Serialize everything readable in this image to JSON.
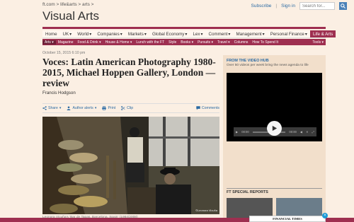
{
  "breadcrumb": {
    "text": "ft.com > life&arts > arts >"
  },
  "top": {
    "subscribe": "Subscribe",
    "separator": "|",
    "signin": "Sign in",
    "search_placeholder": "Search for..."
  },
  "section": {
    "title": "Visual Arts"
  },
  "nav": {
    "items": [
      "Home",
      "UK",
      "World",
      "Companies",
      "Markets",
      "Global Economy",
      "Lex",
      "Comment",
      "Management",
      "Personal Finance",
      "Life & Arts"
    ]
  },
  "subnav": {
    "items": [
      "Arts",
      "Magazine",
      "Food & Drink",
      "House & Home",
      "Lunch with the FT",
      "Style",
      "Books",
      "Pursuits",
      "Travel",
      "Columns",
      "How To Spend It",
      "Tools"
    ]
  },
  "article": {
    "date": "October 15, 2015 6:10 pm",
    "headline": "Voces: Latin American Photography 1980-2015, Michael Hoppen Gallery, London — review",
    "author": "Francis Hodgson",
    "actions": {
      "share": "Share",
      "author_alerts": "Author alerts",
      "print": "Print",
      "clip": "Clip",
      "comments": "Comments"
    },
    "photo_credit": "©Leonora Vicuña",
    "caption": "Leonora Vicuña's 'Bar de Tapas, Barcelona, Spain' (1984/2008)"
  },
  "sidebar": {
    "hub_title": "FROM THE VIDEO HUB",
    "hub_sub": "Over 50 videos per week bring the news agenda to life",
    "video": {
      "time_left": "00:00",
      "time_right": "00:00"
    },
    "special_title": "FT SPECIAL REPORTS"
  },
  "ad": {
    "text": "FINANCIAL TIMES"
  },
  "colors": {
    "accent": "#9e2f50",
    "link": "#2b6aa3",
    "background": "#fbefe3"
  }
}
